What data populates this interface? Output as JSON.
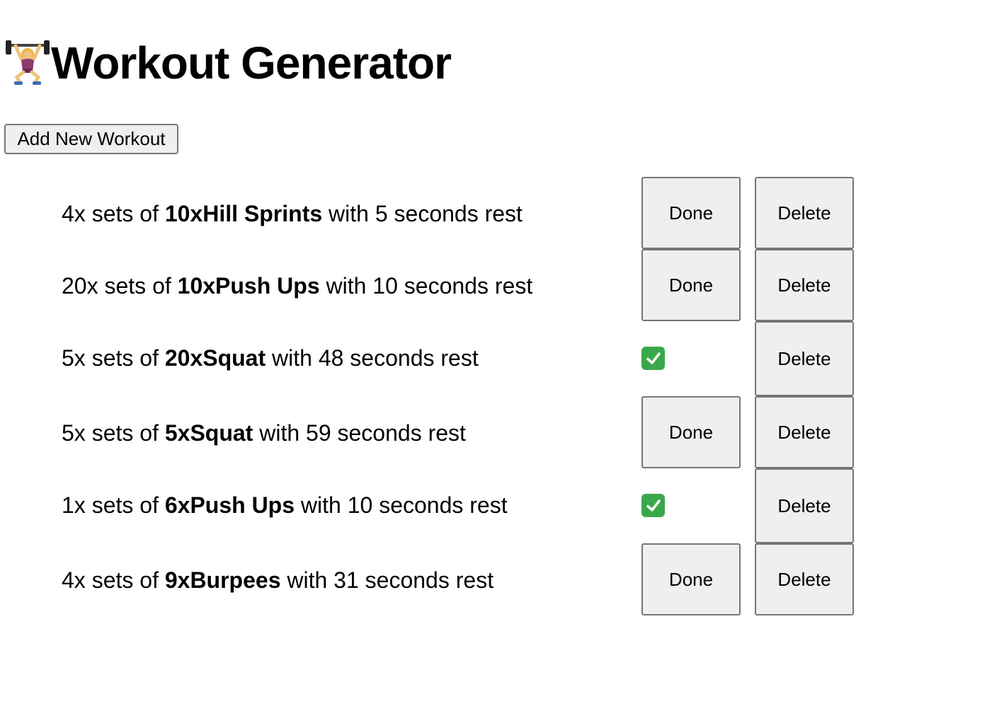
{
  "page": {
    "title": "Workout Generator",
    "title_icon": "weightlifter-icon",
    "add_button_label": "Add New Workout"
  },
  "workouts": [
    {
      "sets": "4x",
      "sets_of": " sets of ",
      "exercise": "10xHill Sprints",
      "rest": " with 5 seconds rest",
      "done": false,
      "done_label": "Done",
      "delete_label": "Delete"
    },
    {
      "sets": "20x",
      "sets_of": " sets of ",
      "exercise": "10xPush Ups",
      "rest": " with 10 seconds rest",
      "done": false,
      "done_label": "Done",
      "delete_label": "Delete"
    },
    {
      "sets": "5x",
      "sets_of": " sets of ",
      "exercise": "20xSquat",
      "rest": " with 48 seconds rest",
      "done": true,
      "done_icon": "check-mark-icon",
      "delete_label": "Delete"
    },
    {
      "sets": "5x",
      "sets_of": " sets of ",
      "exercise": "5xSquat",
      "rest": " with 59 seconds rest",
      "done": false,
      "done_label": "Done",
      "delete_label": "Delete"
    },
    {
      "sets": "1x",
      "sets_of": " sets of ",
      "exercise": "6xPush Ups",
      "rest": " with 10 seconds rest",
      "done": true,
      "done_icon": "check-mark-icon",
      "delete_label": "Delete"
    },
    {
      "sets": "4x",
      "sets_of": " sets of ",
      "exercise": "9xBurpees",
      "rest": " with 31 seconds rest",
      "done": false,
      "done_label": "Done",
      "delete_label": "Delete"
    }
  ],
  "colors": {
    "button_bg": "#efefef",
    "button_border": "#767676",
    "check_green": "#3aa84a"
  }
}
